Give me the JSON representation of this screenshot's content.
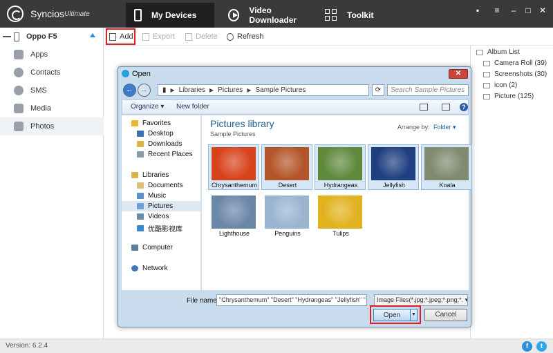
{
  "app": {
    "name": "Syncios",
    "edition": "Ultimate"
  },
  "top_nav": [
    {
      "label": "My Devices"
    },
    {
      "label": "Video Downloader"
    },
    {
      "label": "Toolkit"
    }
  ],
  "window_controls": {
    "minimize": "–",
    "maximize": "□",
    "close": "✕"
  },
  "device": {
    "name": "Oppo F5"
  },
  "sidebar": {
    "items": [
      {
        "label": "Apps",
        "color": "#9aa0a8"
      },
      {
        "label": "Contacts",
        "color": "#9aa0a8"
      },
      {
        "label": "SMS",
        "color": "#9aa0a8"
      },
      {
        "label": "Media",
        "color": "#9aa0a8"
      },
      {
        "label": "Photos",
        "color": "#9aa0a8"
      }
    ]
  },
  "toolbar": {
    "add": "Add",
    "export": "Export",
    "delete": "Delete",
    "refresh": "Refresh"
  },
  "albums": {
    "header": "Album List",
    "items": [
      "Camera Roll (39)",
      "Screenshots (30)",
      "icon (2)",
      "Picture (125)"
    ]
  },
  "status": {
    "version": "Version: 6.2.4"
  },
  "dialog": {
    "title": "Open",
    "close": "✕",
    "address": [
      "Libraries",
      "Pictures",
      "Sample Pictures"
    ],
    "search_placeholder": "Search Sample Pictures",
    "commands": {
      "organize": "Organize ▾",
      "new_folder": "New folder"
    },
    "nav": {
      "favorites": "Favorites",
      "favorites_items": [
        "Desktop",
        "Downloads",
        "Recent Places"
      ],
      "libraries": "Libraries",
      "libraries_items": [
        "Documents",
        "Music",
        "Pictures",
        "Videos",
        "优酷影视库"
      ],
      "computer": "Computer",
      "network": "Network"
    },
    "library": {
      "title": "Pictures library",
      "subtitle": "Sample Pictures",
      "arrange_label": "Arrange by:",
      "arrange_value": "Folder ▾"
    },
    "files": [
      {
        "name": "Chrysanthemum",
        "color": "#d8431b"
      },
      {
        "name": "Desert",
        "color": "#b4552a"
      },
      {
        "name": "Hydrangeas",
        "color": "#5f8a3c"
      },
      {
        "name": "Jellyfish",
        "color": "#1f3f80"
      },
      {
        "name": "Koala",
        "color": "#7f8a6e"
      },
      {
        "name": "Lighthouse",
        "color": "#6b87a8"
      },
      {
        "name": "Penguins",
        "color": "#9ab4cf"
      },
      {
        "name": "Tulips",
        "color": "#e1b21e"
      }
    ],
    "file_name_label": "File name:",
    "file_name_value": "\"Chrysanthemum\" \"Desert\" \"Hydrangeas\" \"Jellyfish\" \"",
    "file_type_value": "Image Files(*.jpg;*.jpeg;*.png;*.",
    "open_label": "Open",
    "cancel_label": "Cancel"
  },
  "colors": {
    "accent": "#2a8fd8",
    "highlight": "#e21c23",
    "topbar": "#3a3a3a"
  }
}
